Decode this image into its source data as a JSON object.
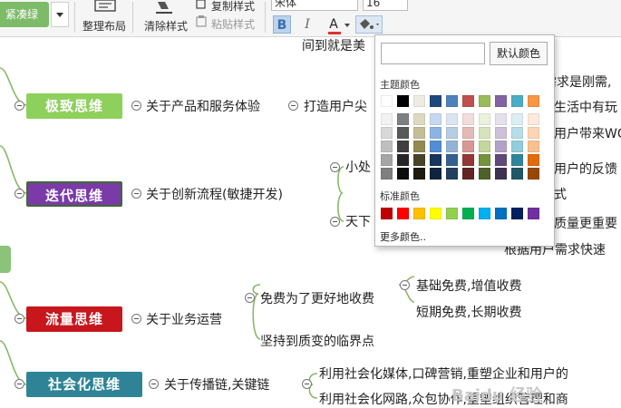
{
  "toolbar": {
    "theme_button": "紧凑绿",
    "tidy_label": "整理布局",
    "clear_style_label": "清除样式",
    "copy_style_label": "复制样式",
    "paste_style_label": "粘贴样式",
    "font_family": "宋体",
    "font_size": "16",
    "bold_label": "B",
    "italic_label": "I",
    "font_color_label": "A",
    "colors": {
      "font_color_bar": "#e03030",
      "theme_green": "#7dbb69"
    }
  },
  "popup": {
    "hex_input_value": "",
    "default_button": "默认颜色",
    "theme_colors_label": "主题颜色",
    "standard_colors_label": "标准颜色",
    "more_colors_label": "更多颜色..",
    "theme_top_row": [
      "#ffffff",
      "#000000",
      "#eeece1",
      "#1f497d",
      "#4f81bd",
      "#c0504d",
      "#9bbb59",
      "#8064a2",
      "#4bacc6",
      "#f79646"
    ],
    "theme_shades": [
      [
        "#f2f2f2",
        "#7f7f7f",
        "#ddd9c3",
        "#c6d9f0",
        "#dbe5f1",
        "#f2dcdb",
        "#ebf1dd",
        "#e5e0ec",
        "#dbeef3",
        "#fdeada"
      ],
      [
        "#d8d8d8",
        "#595959",
        "#c4bd97",
        "#8db3e2",
        "#b8cce4",
        "#e5b9b7",
        "#d7e3bc",
        "#ccc1d9",
        "#b7dde8",
        "#fbd5b5"
      ],
      [
        "#bfbfbf",
        "#3f3f3f",
        "#938953",
        "#548dd4",
        "#95b3d7",
        "#d99694",
        "#c3d69b",
        "#b2a2c7",
        "#92cddc",
        "#fac08f"
      ],
      [
        "#a5a5a5",
        "#262626",
        "#494429",
        "#17365d",
        "#366092",
        "#953734",
        "#76923c",
        "#5f497a",
        "#31859b",
        "#e36c09"
      ],
      [
        "#7f7f7f",
        "#0c0c0c",
        "#1d1b10",
        "#0f243e",
        "#244061",
        "#632423",
        "#4f6128",
        "#3f3151",
        "#205867",
        "#974806"
      ]
    ],
    "standard_colors": [
      "#c00000",
      "#ff0000",
      "#ffc000",
      "#ffff00",
      "#92d050",
      "#00b050",
      "#00b0f0",
      "#0070c0",
      "#002060",
      "#7030a0"
    ]
  },
  "mindmap": {
    "node_colors": {
      "jizhi": "#8ed05c",
      "diedai": "#7a3aa8",
      "liuliang": "#c8161d",
      "shehui": "#2e8496",
      "link_color": "#8ab86a"
    },
    "top_cut_text": "间到就是美",
    "right_fragments": [
      "需求是刚需,",
      "生活中有玩",
      "用户带来WOW",
      "用户的反馈",
      "式",
      "质量更重要",
      "根据用户需求快速"
    ],
    "jizhi": {
      "label": "极致思维",
      "child": "关于产品和服务体验",
      "grandchild": "打造用户尖"
    },
    "diedai": {
      "label": "迭代思维",
      "child": "关于创新流程(敏捷开发)",
      "grandchild_a": "小处",
      "grandchild_b": "天下"
    },
    "liuliang": {
      "label": "流量思维",
      "child": "关于业务运营",
      "grandchild_a": "免费为了更好地收费",
      "gg_a1": "基础免费,增值收费",
      "gg_a2": "短期免费,长期收费",
      "grandchild_b": "坚持到质变的临界点"
    },
    "shehui": {
      "label": "社会化思维",
      "child": "关于传播链,关键链",
      "grandchild_a": "利用社会化媒体,口碑营销,重塑企业和用户的",
      "grandchild_b": "利用社会化网路,众包协作,重塑组织管理和商"
    }
  },
  "watermark": "Baidu 经验"
}
